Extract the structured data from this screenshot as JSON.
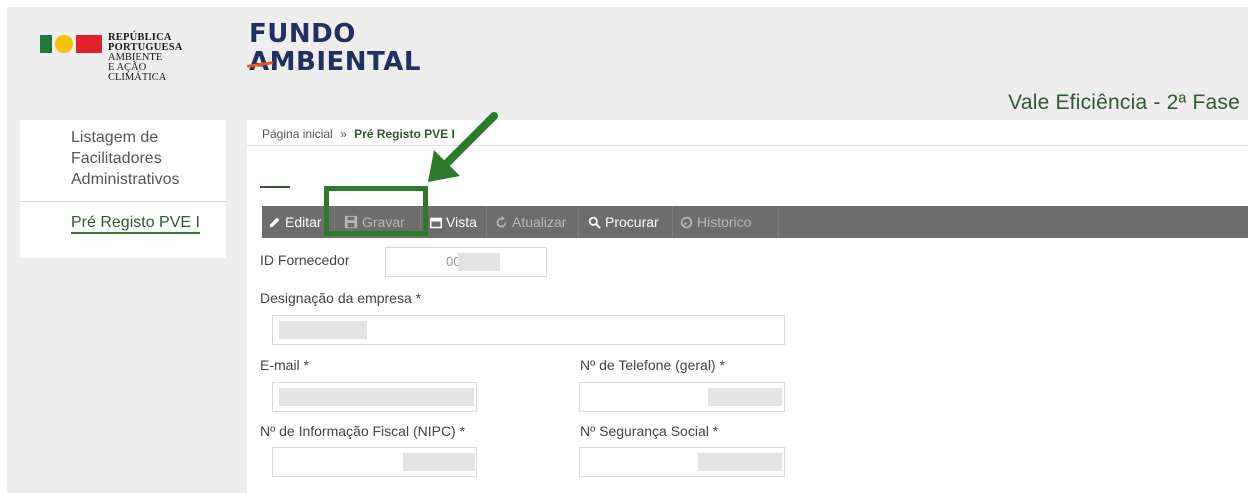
{
  "header": {
    "gov_logo": {
      "line1": "REPÚBLICA",
      "line2": "PORTUGUESA",
      "line3": "AMBIENTE",
      "line4": "E AÇÃO CLIMÁTICA",
      "colors": [
        "#1e7a3a",
        "#f5c000",
        "#e3232b"
      ]
    },
    "fundo_logo": {
      "line1": "FUNDO",
      "line2": "AMBIENTAL"
    },
    "title": "Vale Eficiência - 2ª Fase"
  },
  "sidebar": {
    "items": [
      {
        "label": "Listagem de Facilitadores Administrativos"
      },
      {
        "label": "Pré Registo PVE I",
        "active": true
      }
    ]
  },
  "breadcrumb": {
    "home": "Página inicial",
    "separator": "»",
    "current": "Pré Registo PVE I"
  },
  "toolbar": {
    "editar": "Editar",
    "gravar": "Gravar",
    "vista": "Vista",
    "atualizar": "Atualizar",
    "procurar": "Procurar",
    "historico": "Historico"
  },
  "form": {
    "id_fornecedor": {
      "label": "ID Fornecedor",
      "value": "00"
    },
    "designacao": {
      "label": "Designação da empresa *"
    },
    "email": {
      "label": "E-mail *"
    },
    "telefone": {
      "label": "Nº de Telefone (geral) *"
    },
    "nipc": {
      "label": "Nº de Informação Fiscal (NIPC) *"
    },
    "seguranca_social": {
      "label": "Nº Segurança Social *"
    }
  },
  "colors": {
    "accent_green": "#2e5a2e",
    "highlight_green": "#2d7a2d",
    "toolbar_bg": "#6d6d6d"
  }
}
